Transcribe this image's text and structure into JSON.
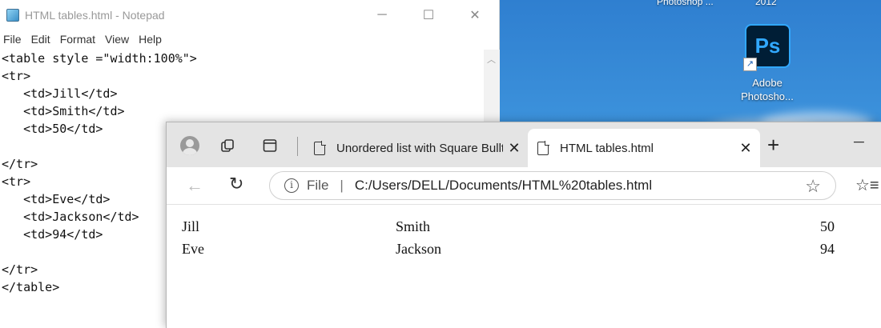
{
  "desktop": {
    "top_labels": [
      "Photoshop ...",
      "2012"
    ],
    "photoshop_icon": {
      "glyph": "Ps",
      "label": "Adobe Photosho..."
    }
  },
  "notepad": {
    "title": "HTML tables.html - Notepad",
    "menu": [
      "File",
      "Edit",
      "Format",
      "View",
      "Help"
    ],
    "lines": [
      "<table style =\"width:100%\">",
      "<tr>",
      "   <td>Jill</td>",
      "   <td>Smith</td>",
      "   <td>50</td>",
      "",
      "</tr>",
      "<tr>",
      "   <td>Eve</td>",
      "   <td>Jackson</td>",
      "   <td>94</td>",
      "",
      "</tr>",
      "</table>"
    ]
  },
  "browser": {
    "tabs": [
      {
        "label": "Unordered list with Square Bullt",
        "active": false
      },
      {
        "label": "HTML tables.html",
        "active": true
      }
    ],
    "address": {
      "scheme_label": "File",
      "url": "C:/Users/DELL/Documents/HTML%20tables.html"
    },
    "table": [
      [
        "Jill",
        "Smith",
        "50"
      ],
      [
        "Eve",
        "Jackson",
        "94"
      ]
    ]
  }
}
